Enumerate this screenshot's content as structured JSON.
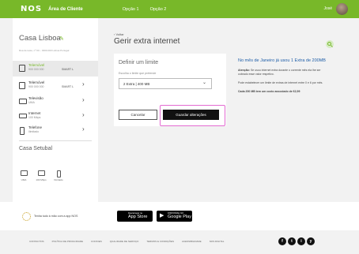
{
  "header": {
    "logo": "NOS",
    "area": "Área de Cliente",
    "nav": [
      "Opção 1",
      "Opção 2"
    ],
    "user": "José"
  },
  "sidebar": {
    "title": "Casa Lisboa",
    "address": "Rua de teste, nº 00 – 0000-000 Lisboa Portugal",
    "items": [
      {
        "label": "Telemóvel",
        "sub": "900 000 000",
        "plan": "SMART L",
        "icon": "phone-icon"
      },
      {
        "label": "Telemóvel",
        "sub": "900 000 000",
        "plan": "SMART L",
        "icon": "phone-icon"
      },
      {
        "label": "Televisão",
        "sub": "UMA",
        "plan": "",
        "icon": "tv-icon"
      },
      {
        "label": "Internet",
        "sub": "100 Mbps",
        "plan": "",
        "icon": "laptop-icon"
      },
      {
        "label": "Telefone",
        "sub": "Ilimitado",
        "plan": "",
        "icon": "landline-phone-icon"
      }
    ],
    "title2": "Casa Setubal",
    "services": [
      {
        "label": "UMA",
        "icon": "tv-icon"
      },
      {
        "label": "100 Mbps",
        "icon": "laptop-icon"
      },
      {
        "label": "Ilimitado",
        "icon": "landline-phone-icon"
      }
    ]
  },
  "main": {
    "back": "Voltar",
    "title": "Gerir extra internet",
    "card": {
      "title": "Definir um limite",
      "label": "Escolha o limite que pretende",
      "select_value": "2 Extra | 400 MB",
      "cancel": "Cancelar",
      "save": "Guardar alterações"
    },
    "info": {
      "heading": "No mês de Janeiro já usou 1 Extra de 200MB",
      "p1_bold": "Atenção:",
      "p1": "Se usou internet extra durante o corrente mês ela lhe ser cobrado esse valor respetivo.",
      "p2": "Pode estabelecer um limite de extras de internet entre 0 e 6 por mês.",
      "p3": "Cada 200 MB tem um custo associado de €2,99"
    }
  },
  "app": {
    "text": "Tenha tudo à mão com a app NOS",
    "appstore_small": "Descarregar na",
    "appstore_big": "App Store",
    "google_small": "DISPONÍVEL NO",
    "google_big": "Google Play"
  },
  "footer": {
    "links": [
      "CONTACTOS",
      "POLÍTICA DE PRIVACIDADE",
      "COOKIES",
      "QUALIDADE DE SERVIÇO",
      "TERMOS E CONDIÇÕES",
      "ACESSIBILIDADE",
      "NOS DIGITAL"
    ],
    "social": [
      "f",
      "t",
      "i",
      "y"
    ]
  },
  "colors": {
    "accent": "#78b829",
    "info_heading": "#1f5ea8",
    "highlight": "#e36bd2"
  }
}
